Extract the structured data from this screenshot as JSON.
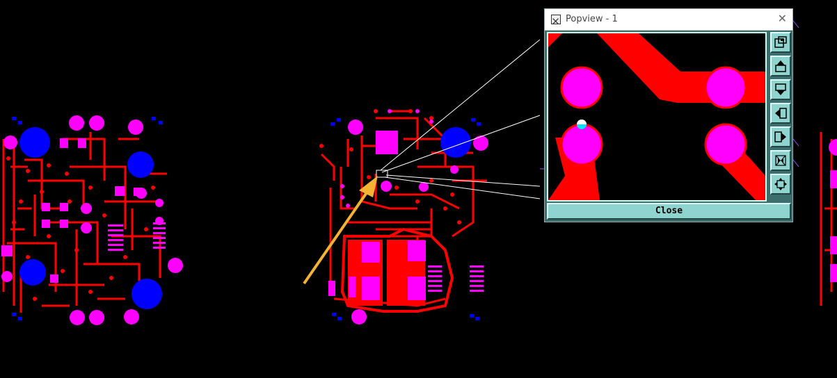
{
  "popview": {
    "title": "Popview - 1",
    "close_glyph": "✕",
    "close_button_label": "Close",
    "toolbar_icons": [
      "zoom-fit-icon",
      "zoom-in-icon",
      "zoom-out-icon",
      "pan-left-icon",
      "pan-right-icon",
      "zoom-extents-icon",
      "pan-center-icon"
    ]
  },
  "colors": {
    "background": "#000000",
    "trace": "#ff0000",
    "pad": "#ff00ff",
    "via_large": "#0000ff",
    "pointer": "#f5b335",
    "dialog_frame": "#3c6e6e",
    "dialog_button": "#8fd4cf"
  }
}
